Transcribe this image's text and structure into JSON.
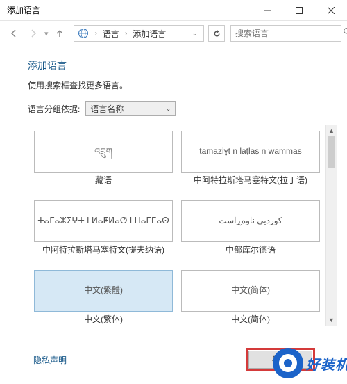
{
  "window": {
    "title": "添加语言"
  },
  "nav": {
    "bc_root": "语言",
    "bc_current": "添加语言",
    "search_placeholder": "搜索语言"
  },
  "page": {
    "heading": "添加语言",
    "subtext": "使用搜索框查找更多语言。",
    "group_label": "语言分组依据:",
    "group_value": "语言名称"
  },
  "langs": [
    {
      "native": "འབྲུག",
      "caption": "藏语",
      "selected": false,
      "tibetan": true
    },
    {
      "native": "tamaziɣt n laṭlaṣ n wammas",
      "caption": "中阿特拉斯塔马塞特文(拉丁语)",
      "selected": false
    },
    {
      "native": "ⵜⴰⵎⴰⵣⵉⵖⵜ ⵏ ⵍⴰⵟⵍⴰⵚ ⵏ ⵡⴰⵎⵎⴰⵙ",
      "caption": "中阿特拉斯塔马塞特文(提夫纳语)",
      "selected": false
    },
    {
      "native": "کوردیی ناوەڕاست",
      "caption": "中部库尔德语",
      "selected": false
    },
    {
      "native": "中文(繁體)",
      "caption": "中文(繁体)",
      "selected": true
    },
    {
      "native": "中文(简体)",
      "caption": "中文(简体)",
      "selected": false
    }
  ],
  "footer": {
    "privacy": "隐私声明",
    "open": "打开"
  },
  "watermark": {
    "text": "好装机"
  }
}
